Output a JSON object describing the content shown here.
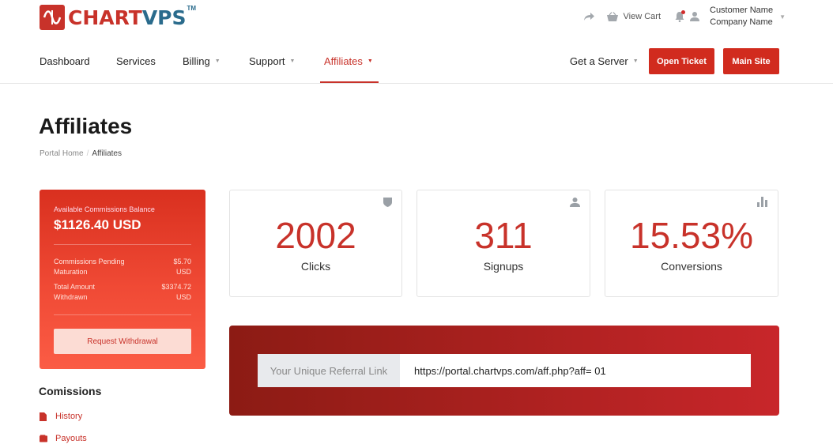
{
  "brand": {
    "name_part1": "CHART",
    "name_part2": "VPS",
    "tm": "TM",
    "primary_color": "#c8322a",
    "secondary_color": "#2a6b8c"
  },
  "topbar": {
    "view_cart": "View Cart",
    "customer_name": "Customer Name",
    "company_name": "Company Name"
  },
  "nav": {
    "items": [
      {
        "label": "Dashboard"
      },
      {
        "label": "Services"
      },
      {
        "label": "Billing"
      },
      {
        "label": "Support"
      },
      {
        "label": "Affiliates"
      }
    ],
    "get_server": "Get a Server",
    "open_ticket": "Open Ticket",
    "main_site": "Main Site"
  },
  "page": {
    "title": "Affiliates",
    "breadcrumb": {
      "home": "Portal Home",
      "sep": "/",
      "current": "Affiliates"
    }
  },
  "commissions": {
    "balance_label": "Available Commissions Balance",
    "balance": "$1126.40 USD",
    "pending_label_1": "Commissions Pending",
    "pending_label_2": "Maturation",
    "pending_value_1": "$5.70",
    "pending_value_2": "USD",
    "withdrawn_label_1": "Total Amount",
    "withdrawn_label_2": "Withdrawn",
    "withdrawn_value_1": "$3374.72",
    "withdrawn_value_2": "USD",
    "withdraw_button": "Request Withdrawal"
  },
  "sidebar": {
    "title": "Comissions",
    "links": [
      {
        "label": "History"
      },
      {
        "label": "Payouts"
      }
    ]
  },
  "stats": [
    {
      "value": "2002",
      "label": "Clicks",
      "icon": "shield-icon"
    },
    {
      "value": "311",
      "label": "Signups",
      "icon": "user-icon"
    },
    {
      "value": "15.53%",
      "label": "Conversions",
      "icon": "bar-chart-icon"
    }
  ],
  "referral": {
    "label": "Your Unique Referral Link",
    "url": "https://portal.chartvps.com/aff.php?aff= 01"
  }
}
